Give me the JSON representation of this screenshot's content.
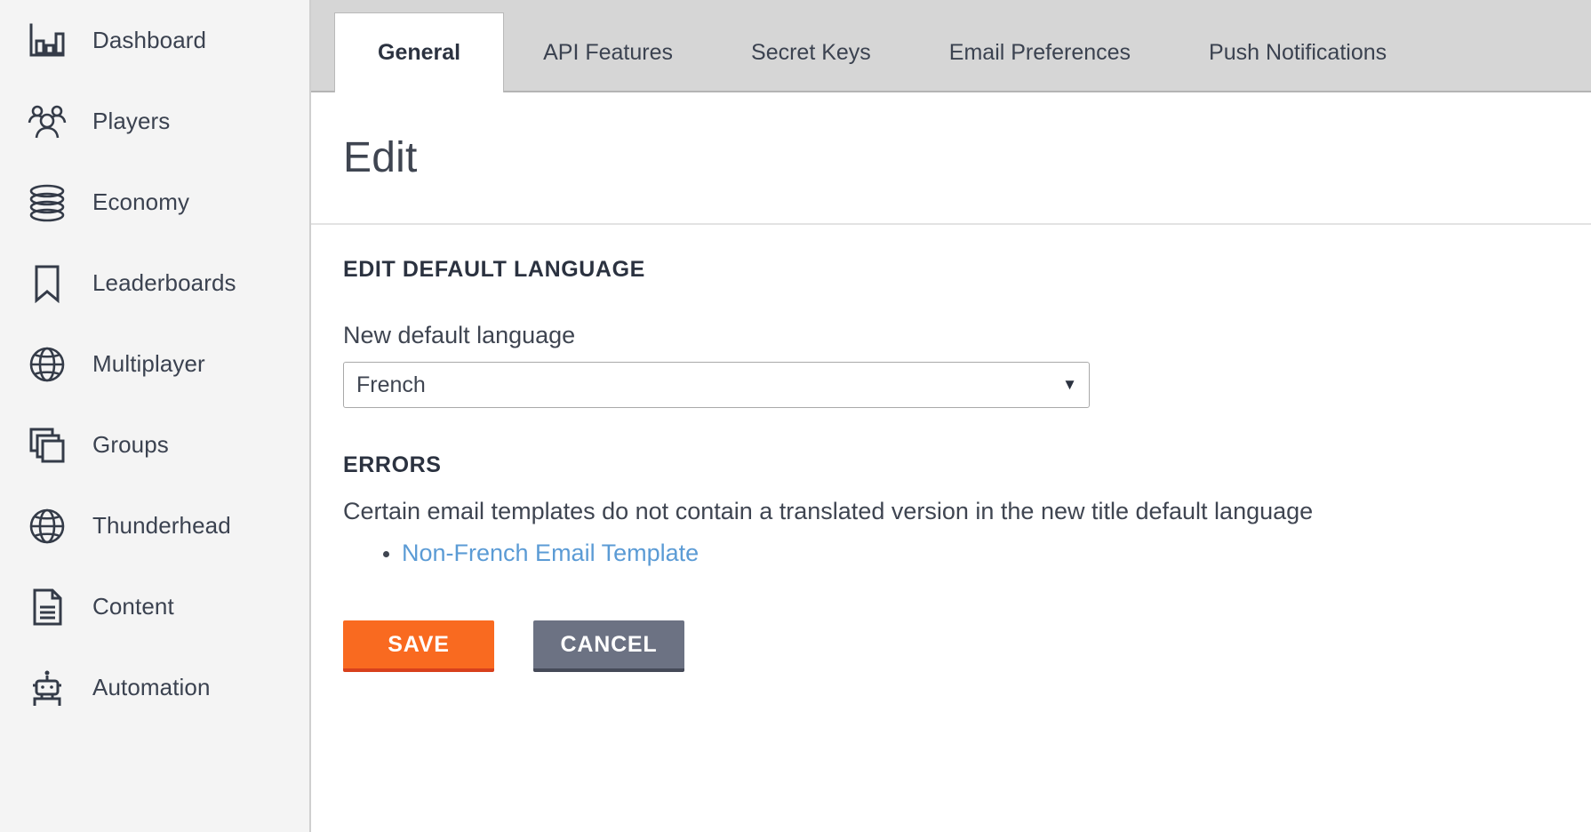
{
  "sidebar": {
    "items": [
      {
        "label": "Dashboard",
        "icon": "bar-chart-icon"
      },
      {
        "label": "Players",
        "icon": "people-group-icon"
      },
      {
        "label": "Economy",
        "icon": "coin-stack-icon"
      },
      {
        "label": "Leaderboards",
        "icon": "bookmark-icon"
      },
      {
        "label": "Multiplayer",
        "icon": "globe-icon"
      },
      {
        "label": "Groups",
        "icon": "stacked-windows-icon"
      },
      {
        "label": "Thunderhead",
        "icon": "globe-icon"
      },
      {
        "label": "Content",
        "icon": "document-icon"
      },
      {
        "label": "Automation",
        "icon": "robot-icon"
      }
    ]
  },
  "tabs": [
    {
      "label": "General",
      "active": true
    },
    {
      "label": "API Features",
      "active": false
    },
    {
      "label": "Secret Keys",
      "active": false
    },
    {
      "label": "Email Preferences",
      "active": false
    },
    {
      "label": "Push Notifications",
      "active": false
    }
  ],
  "page": {
    "title": "Edit"
  },
  "form": {
    "section_title": "EDIT DEFAULT LANGUAGE",
    "field_label": "New default language",
    "language_value": "French",
    "language_options": [
      "French"
    ]
  },
  "errors": {
    "title": "ERRORS",
    "message": "Certain email templates do not contain a translated version in the new title default language",
    "items": [
      {
        "label": "Non-French Email Template"
      }
    ]
  },
  "actions": {
    "save_label": "SAVE",
    "cancel_label": "CANCEL"
  },
  "colors": {
    "accent_orange": "#f96a20",
    "accent_orange_shadow": "#d8401c",
    "cancel_gray": "#6c7283",
    "cancel_gray_shadow": "#454a58",
    "link_blue": "#5b9bd5",
    "sidebar_bg": "#f4f4f4",
    "tabbar_bg": "#d6d6d6",
    "text_dark": "#3f4551"
  }
}
